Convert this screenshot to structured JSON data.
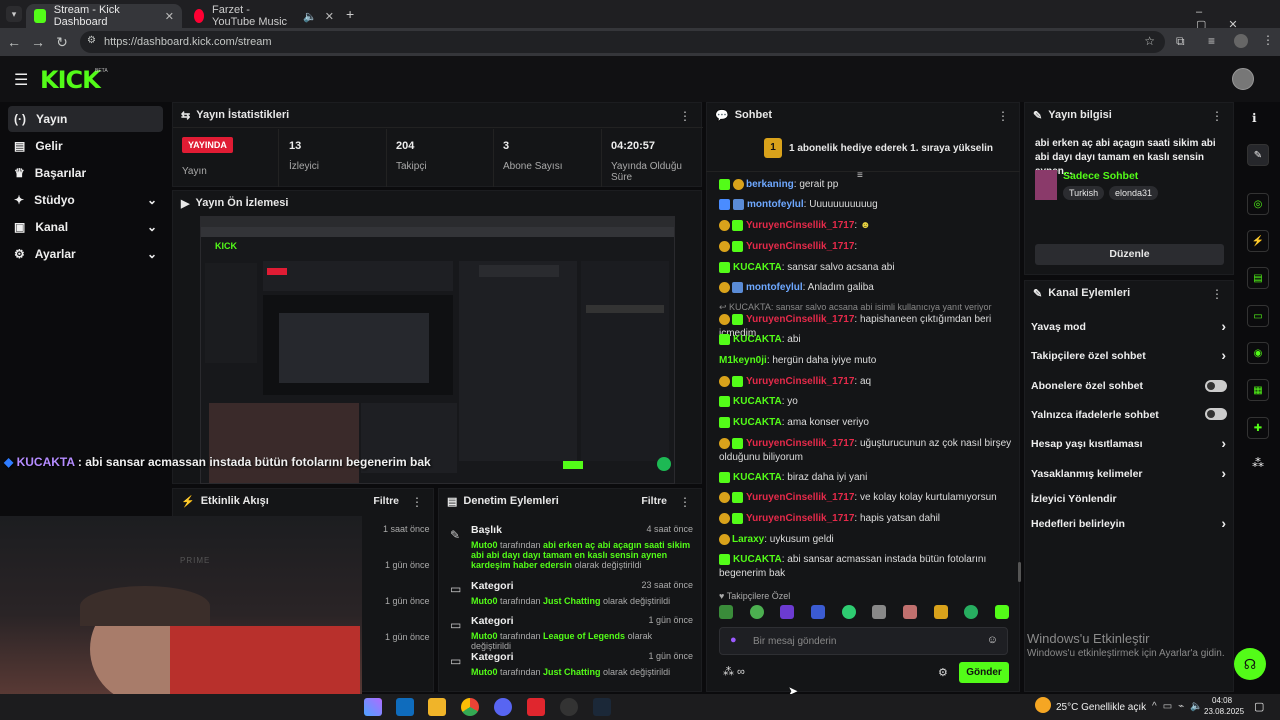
{
  "browser": {
    "tabs": [
      {
        "title": "Stream - Kick Dashboard",
        "active": true
      },
      {
        "title": "Farzet - YouTube Music",
        "active": false
      }
    ],
    "url": "https://dashboard.kick.com/stream"
  },
  "brand": {
    "logo": "KICK",
    "beta": "BETA",
    "accent": "#53fc18"
  },
  "sidebar": {
    "items": [
      {
        "label": "Yayın",
        "icon": "broadcast-icon",
        "active": true
      },
      {
        "label": "Gelir",
        "icon": "revenue-icon"
      },
      {
        "label": "Başarılar",
        "icon": "trophy-icon"
      },
      {
        "label": "Stüdyo",
        "icon": "studio-icon",
        "expandable": true
      },
      {
        "label": "Kanal",
        "icon": "channel-icon",
        "expandable": true
      },
      {
        "label": "Ayarlar",
        "icon": "gear-icon",
        "expandable": true
      }
    ]
  },
  "stats": {
    "title": "Yayın İstatistikleri",
    "live_badge": "YAYINDA",
    "live_label": "Yayın",
    "viewers": {
      "value": "13",
      "label": "İzleyici"
    },
    "followers": {
      "value": "204",
      "label": "Takipçi"
    },
    "subs": {
      "value": "3",
      "label": "Abone Sayısı"
    },
    "uptime": {
      "value": "04:20:57",
      "label": "Yayında Olduğu Süre"
    }
  },
  "preview": {
    "title": "Yayın Ön İzlemesi"
  },
  "overlay_chat": {
    "user": "KUCAKTA",
    "text": " : abi sansar acmassan instada bütün fotolarını begenerim bak"
  },
  "activity": {
    "title": "Etkinlik Akışı",
    "filter": "Filtre",
    "times": [
      "1 saat önce",
      "1 gün önce",
      "1 gün önce",
      "1 gün önce"
    ]
  },
  "moderation": {
    "title": "Denetim Eylemleri",
    "filter": "Filtre",
    "items": [
      {
        "title": "Başlık",
        "time": "4 saat önce",
        "user": "Muto0",
        "mid": " tarafından ",
        "value": "abi erken aç abi açagın saati sikim abi abi dayı dayı tamam en kaslı sensin aynen kardeşim haber edersin",
        "end": " olarak değiştirildi"
      },
      {
        "title": "Kategori",
        "time": "23 saat önce",
        "user": "Muto0",
        "mid": " tarafından ",
        "value": "Just Chatting",
        "end": " olarak değiştirildi"
      },
      {
        "title": "Kategori",
        "time": "1 gün önce",
        "user": "Muto0",
        "mid": " tarafından ",
        "value": "League of Legends",
        "end": " olarak değiştirildi"
      },
      {
        "title": "Kategori",
        "time": "1 gün önce",
        "user": "Muto0",
        "mid": " tarafından ",
        "value": "Just Chatting",
        "end": " olarak değiştirildi"
      }
    ]
  },
  "chat": {
    "title": "Sohbet",
    "pinned": "1 abonelik hediye ederek 1. sıraya yükselin",
    "messages": [
      {
        "user": "berkaning",
        "text": ": gerait pp",
        "color": "blue"
      },
      {
        "user": "montofeylul",
        "text": ": Uuuuuuuuuuug",
        "color": "blue"
      },
      {
        "user": "YuruyenCinsellik_1717",
        "text": ":",
        "color": "red"
      },
      {
        "user": "YuruyenCinsellik_1717",
        "text": ":",
        "color": "red"
      },
      {
        "user": "KUCAKTA",
        "text": ": sansar salvo acsana abi",
        "color": "green"
      },
      {
        "user": "montofeylul",
        "text": ": Anladım galiba",
        "color": "blue"
      },
      {
        "user": "YuruyenCinsellik_1717",
        "text": ": hapishaneen çıktığımdan beri içmedim",
        "color": "red"
      },
      {
        "user": "KUCAKTA",
        "text": ": abi",
        "color": "green"
      },
      {
        "user": "M1keyn0ji",
        "text": ": hergün daha iyiye muto",
        "color": "green"
      },
      {
        "user": "YuruyenCinsellik_1717",
        "text": ": aq",
        "color": "red"
      },
      {
        "user": "KUCAKTA",
        "text": ": yo",
        "color": "green"
      },
      {
        "user": "KUCAKTA",
        "text": ": ama konser veriyo",
        "color": "green"
      },
      {
        "user": "YuruyenCinsellik_1717",
        "text": ": uğuşturucunun az çok nasıl birşey olduğunu biliyorum",
        "color": "red"
      },
      {
        "user": "KUCAKTA",
        "text": ": biraz daha iyi yani",
        "color": "green"
      },
      {
        "user": "YuruyenCinsellik_1717",
        "text": ": ve kolay kolay kurtulamıyorsun",
        "color": "red"
      },
      {
        "user": "YuruyenCinsellik_1717",
        "text": ": hapis yatsan dahil",
        "color": "red"
      },
      {
        "user": "Laraxy",
        "text": ": uykusum geldi",
        "color": "green"
      },
      {
        "user": "KUCAKTA",
        "text": ": abi sansar acmassan instada bütün fotolarını begenerim bak",
        "color": "green"
      }
    ],
    "reply_note": "KUCAKTA: sansar salvo acsana abi isimli kullanıcıya yanıt veriyor",
    "followers_only": "Takipçilere Özel",
    "input_placeholder": "Bir mesaj gönderin",
    "send": "Gönder"
  },
  "stream_info": {
    "title": "Yayın bilgisi",
    "stream_title": "abi erken aç abi açagın saati sikim abi abi dayı dayı tamam en kaslı sensin aynen...",
    "mode": "Sadece Sohbet",
    "tags": [
      "Turkish",
      "elonda31"
    ],
    "edit": "Düzenle"
  },
  "channel_actions": {
    "title": "Kanal Eylemleri",
    "items": [
      {
        "label": "Yavaş mod",
        "type": "arrow"
      },
      {
        "label": "Takipçilere özel sohbet",
        "type": "arrow"
      },
      {
        "label": "Abonelere özel sohbet",
        "type": "toggle"
      },
      {
        "label": "Yalnızca ifadelerle sohbet",
        "type": "toggle"
      },
      {
        "label": "Hesap yaşı kısıtlaması",
        "type": "arrow"
      },
      {
        "label": "Yasaklanmış kelimeler",
        "type": "arrow"
      },
      {
        "label": "İzleyici Yönlendir",
        "type": "none"
      },
      {
        "label": "Hedefleri belirleyin",
        "type": "arrow"
      }
    ]
  },
  "windows": {
    "activate_title": "Windows'u Etkinleştir",
    "activate_sub": "Windows'u etkinleştirmek için Ayarlar'a gidin.",
    "weather": "25°C  Genellikle açık",
    "time": "04:08",
    "date": "23.08.2025"
  }
}
